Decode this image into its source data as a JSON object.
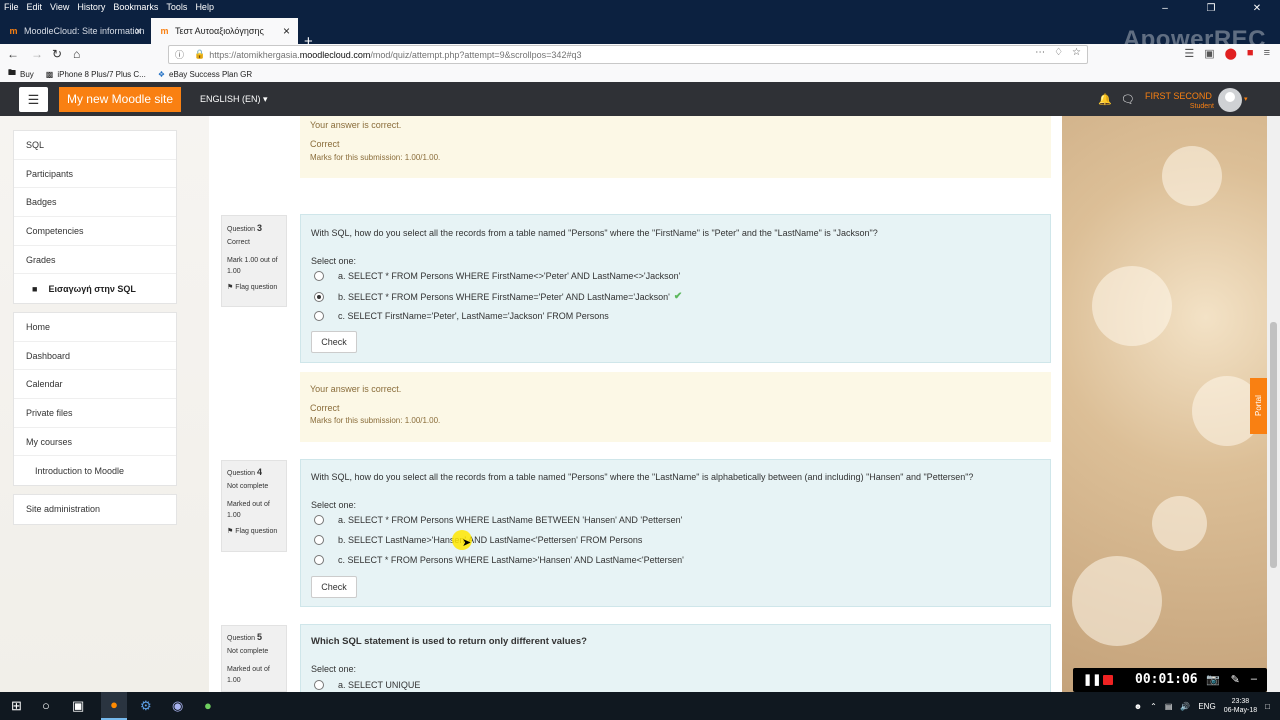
{
  "menubar": [
    "File",
    "Edit",
    "View",
    "History",
    "Bookmarks",
    "Tools",
    "Help"
  ],
  "browser": {
    "tabs": [
      {
        "title": "MoodleCloud: Site information",
        "active": false
      },
      {
        "title": "Τεστ Αυτοαξιολόγησης",
        "active": true
      }
    ],
    "new_tab": "+",
    "url_prefix": "https://atomikhergasia.",
    "url_domain": "moodlecloud.com",
    "url_path": "/mod/quiz/attempt.php?attempt=9&scrollpos=342#q3",
    "bookmarks": [
      "Buy",
      "iPhone 8 Plus/7 Plus C...",
      "eBay Success Plan GR"
    ],
    "watermark": "ApowerREC"
  },
  "header": {
    "site_name": "My new Moodle site",
    "language": "ENGLISH (EN)",
    "user_name": "FIRST SECOND",
    "user_role": "Student"
  },
  "sidebar": {
    "course_items": [
      {
        "label": "SQL"
      },
      {
        "label": "Participants"
      },
      {
        "label": "Badges"
      },
      {
        "label": "Competencies"
      },
      {
        "label": "Grades"
      },
      {
        "label": "Εισαγωγή στην SQL"
      }
    ],
    "nav_items": [
      {
        "label": "Home"
      },
      {
        "label": "Dashboard"
      },
      {
        "label": "Calendar"
      },
      {
        "label": "Private files"
      },
      {
        "label": "My courses"
      },
      {
        "label": "Introduction to Moodle"
      }
    ],
    "admin_items": [
      {
        "label": "Site administration"
      }
    ]
  },
  "feedback_top": {
    "answer": "Your answer is correct.",
    "state": "Correct",
    "marks": "Marks for this submission: 1.00/1.00."
  },
  "questions": {
    "q3": {
      "label": "Question",
      "number": "3",
      "status": "Correct",
      "mark": "Mark 1.00 out of 1.00",
      "flag": "Flag question",
      "text": "With SQL, how do you select all the records from a table named \"Persons\" where the \"FirstName\" is \"Peter\" and the \"LastName\" is \"Jackson\"?",
      "select_one": "Select one:",
      "options": [
        "a. SELECT * FROM Persons WHERE FirstName<>'Peter' AND LastName<>'Jackson'",
        "b. SELECT * FROM Persons WHERE FirstName='Peter' AND LastName='Jackson'",
        "c. SELECT FirstName='Peter', LastName='Jackson' FROM Persons"
      ],
      "selected": 1,
      "check": "Check",
      "feedback": {
        "answer": "Your answer is correct.",
        "state": "Correct",
        "marks": "Marks for this submission: 1.00/1.00."
      }
    },
    "q4": {
      "label": "Question",
      "number": "4",
      "status": "Not complete",
      "mark": "Marked out of 1.00",
      "flag": "Flag question",
      "text": "With SQL, how do you select all the records from a table named \"Persons\" where the \"LastName\" is alphabetically between (and including) \"Hansen\" and \"Pettersen\"?",
      "select_one": "Select one:",
      "options": [
        "a. SELECT * FROM Persons WHERE LastName BETWEEN 'Hansen' AND 'Pettersen'",
        "b. SELECT LastName>'Hansen' AND LastName<'Pettersen' FROM Persons",
        "c. SELECT * FROM Persons WHERE LastName>'Hansen' AND LastName<'Pettersen'"
      ],
      "check": "Check"
    },
    "q5": {
      "label": "Question",
      "number": "5",
      "status": "Not complete",
      "mark": "Marked out of 1.00",
      "text": "Which SQL statement is used to return only different values?",
      "select_one": "Select one:",
      "options": [
        "a. SELECT UNIQUE"
      ]
    }
  },
  "portal_tab": "Portal",
  "recorder": {
    "time": "00:01:06"
  },
  "taskbar": {
    "language": "ENG",
    "time": "23:38",
    "date": "06-May-18"
  }
}
